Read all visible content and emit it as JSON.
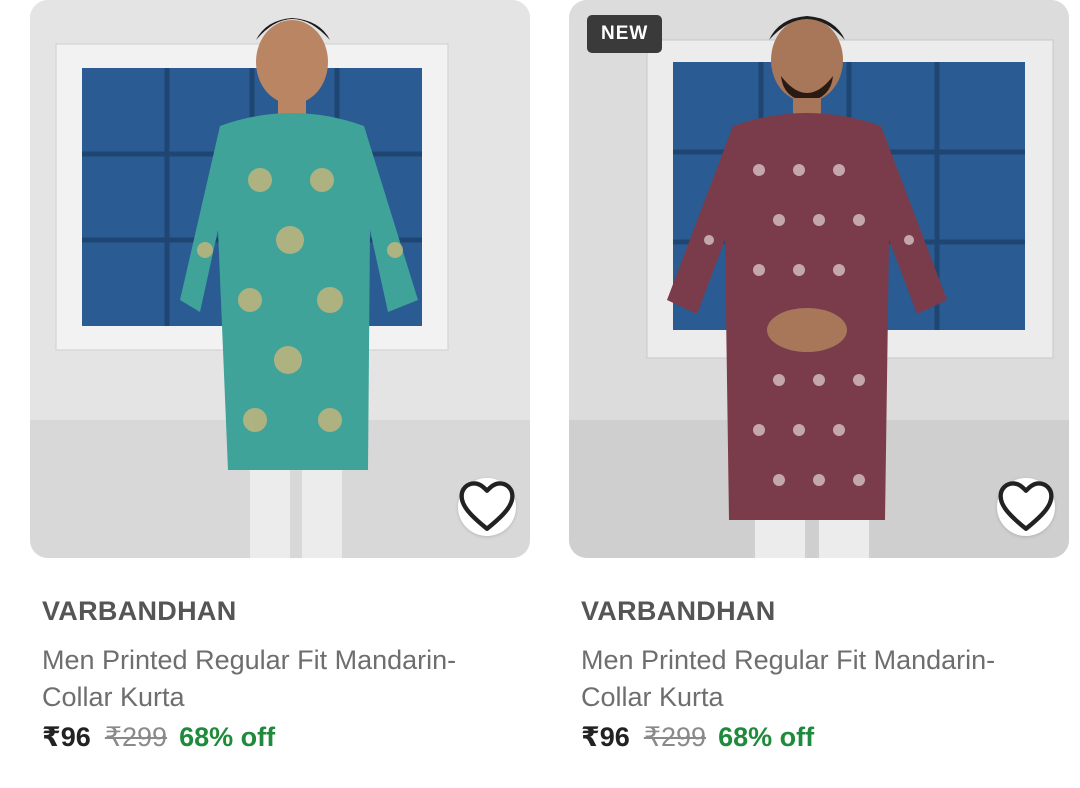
{
  "products": [
    {
      "brand": "VARBANDHAN",
      "title": "Men Printed Regular Fit Mandarin-Collar Kurta",
      "price": "₹96",
      "mrp": "₹299",
      "discount": "68% off",
      "badge": "",
      "kurta_color": "#3fa39a",
      "wishlist_icon": "heart-outline-icon"
    },
    {
      "brand": "VARBANDHAN",
      "title": "Men Printed Regular Fit Mandarin-Collar Kurta",
      "price": "₹96",
      "mrp": "₹299",
      "discount": "68% off",
      "badge": "NEW",
      "kurta_color": "#7a3b4a",
      "wishlist_icon": "heart-outline-icon"
    }
  ],
  "colors": {
    "discount_green": "#1f8a3b",
    "brand_text": "#555555",
    "window_blue": "#2a5c93"
  }
}
